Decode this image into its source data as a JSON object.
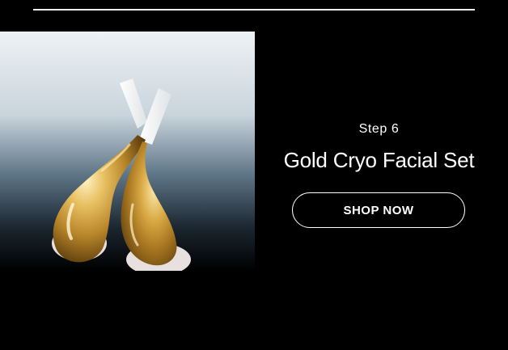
{
  "promo": {
    "step_label": "Step 6",
    "product_title": "Gold Cryo Facial Set",
    "cta_label": "SHOP NOW"
  },
  "image": {
    "subject": "gold-cryo-facial-tools"
  },
  "colors": {
    "background": "#000000",
    "text": "#ffffff",
    "gold": "#c9962e",
    "image_backdrop_top": "#eef2f5",
    "image_backdrop_mid": "#5d7587"
  }
}
